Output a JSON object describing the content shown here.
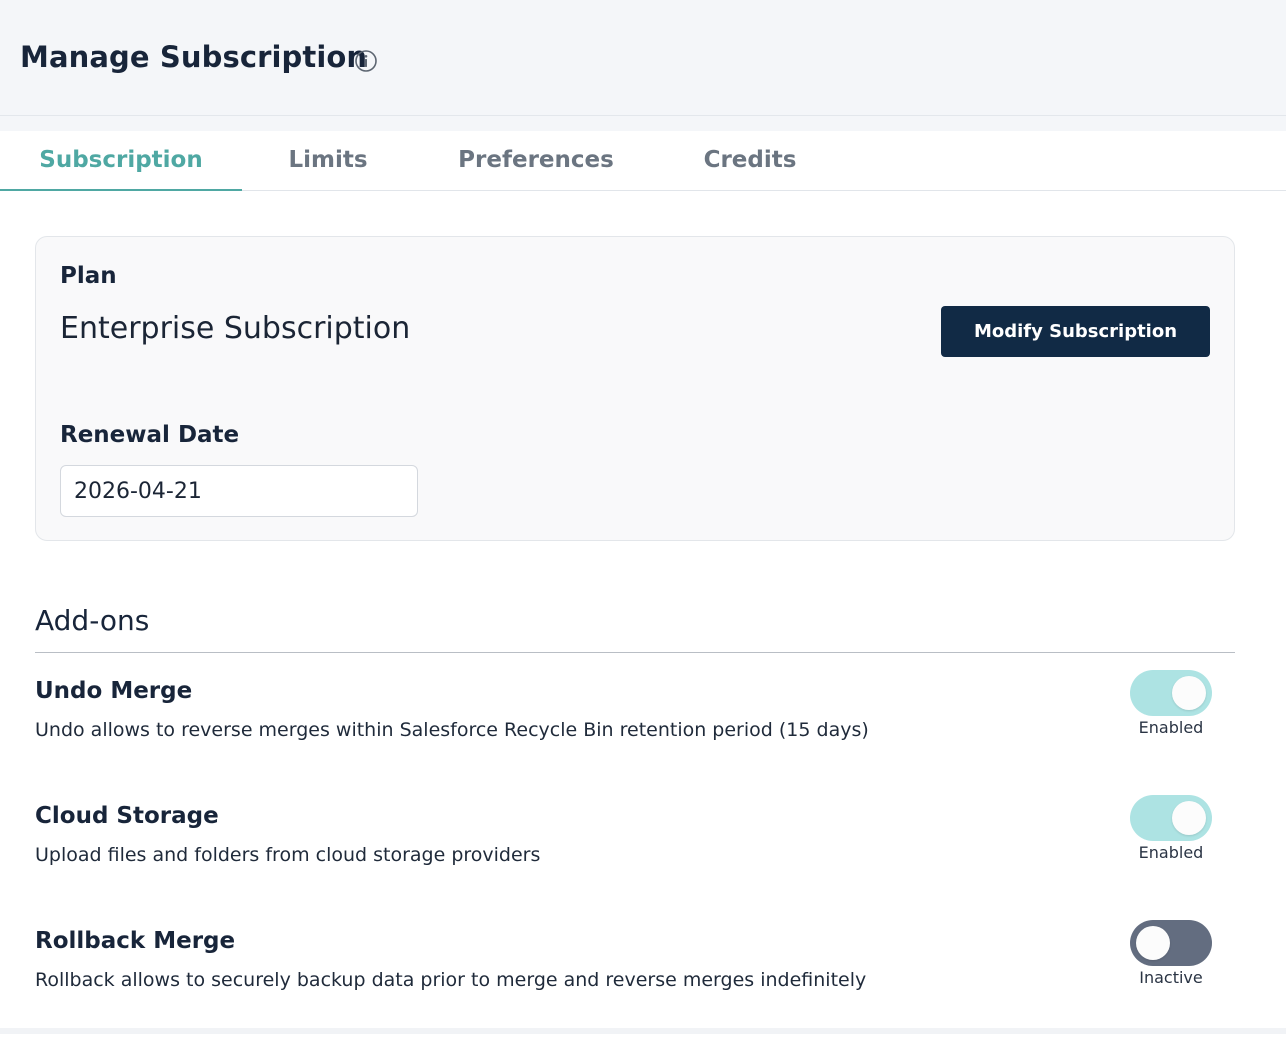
{
  "header": {
    "title": "Manage Subscription",
    "info_icon": "info-icon"
  },
  "tabs": [
    {
      "label": "Subscription",
      "active": true
    },
    {
      "label": "Limits",
      "active": false
    },
    {
      "label": "Preferences",
      "active": false
    },
    {
      "label": "Credits",
      "active": false
    }
  ],
  "plan": {
    "label": "Plan",
    "name": "Enterprise Subscription",
    "modify_label": "Modify Subscription",
    "renewal_label": "Renewal Date",
    "renewal_value": "2026-04-21"
  },
  "addons": {
    "title": "Add-ons",
    "items": [
      {
        "name": "Undo Merge",
        "description": "Undo allows to reverse merges within Salesforce Recycle Bin retention period (15 days)",
        "enabled": true,
        "status": "Enabled"
      },
      {
        "name": "Cloud Storage",
        "description": "Upload files and folders from cloud storage providers",
        "enabled": true,
        "status": "Enabled"
      },
      {
        "name": "Rollback Merge",
        "description": "Rollback allows to securely backup data prior to merge and reverse merges indefinitely",
        "enabled": false,
        "status": "Inactive"
      }
    ]
  },
  "colors": {
    "accent": "#4fa8a3",
    "primary_button": "#112a45",
    "toggle_on": "#ade3e3",
    "toggle_off": "#636d80"
  }
}
